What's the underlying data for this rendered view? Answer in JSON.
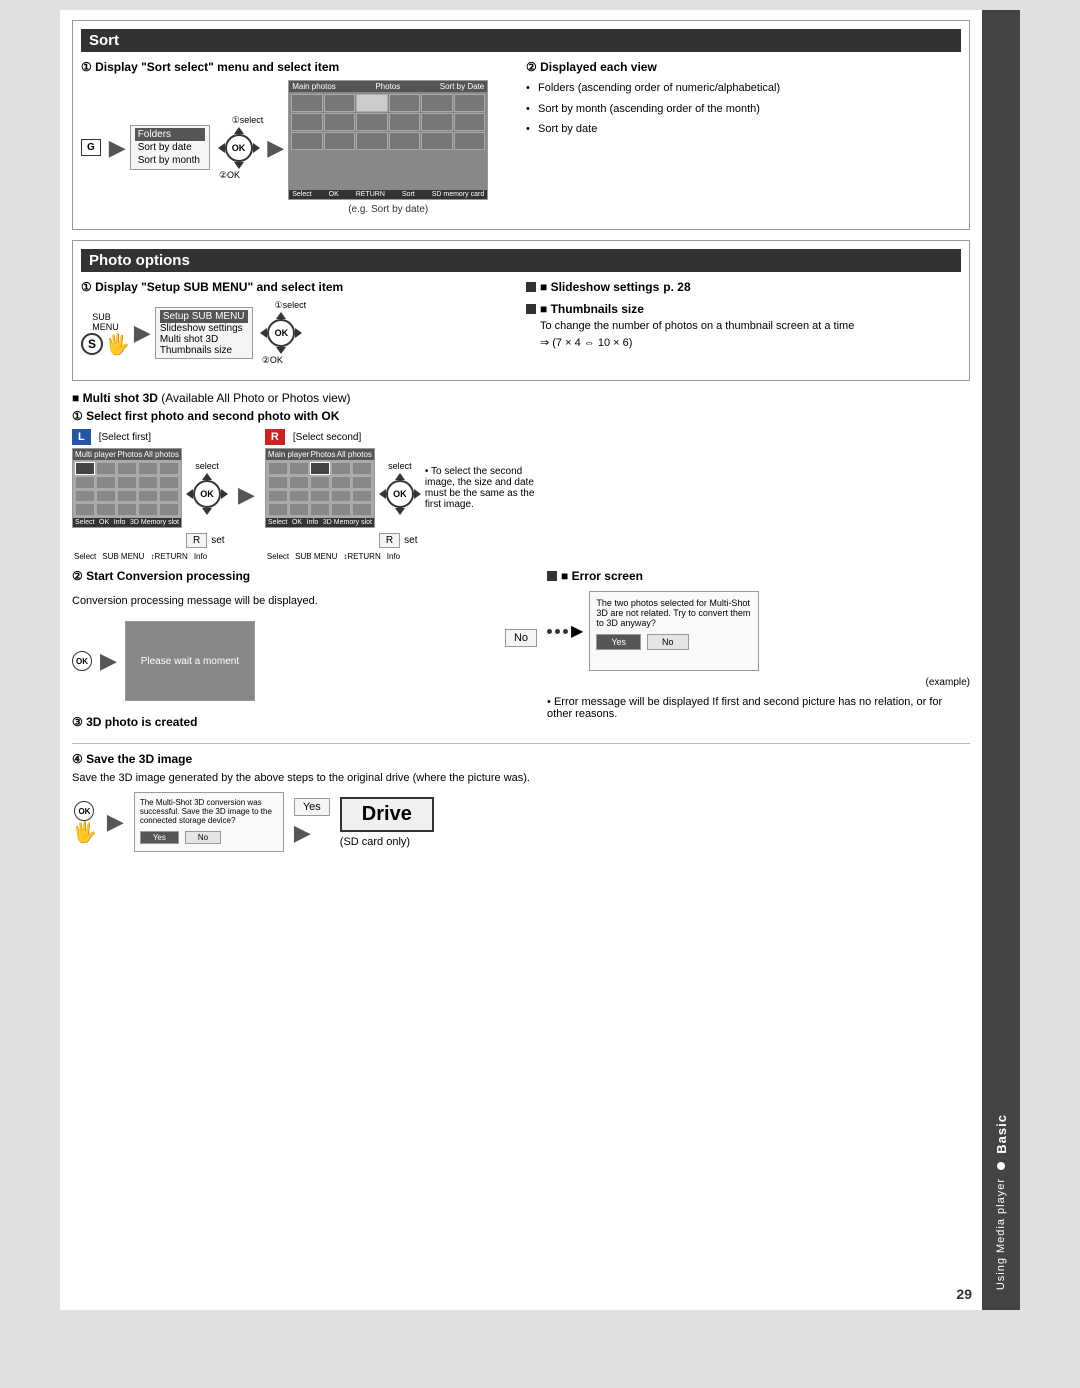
{
  "page": {
    "number": "29",
    "side_tab": {
      "basic_label": "Basic",
      "using_label": "Using Media player"
    }
  },
  "sort_section": {
    "header": "Sort",
    "step1": {
      "title": "① Display \"Sort select\" menu and select item",
      "select_label": "①select",
      "ok_label": "②OK",
      "g_label": "G",
      "menu_items": [
        {
          "label": "Folders",
          "selected": true
        },
        {
          "label": "Sort by date",
          "selected": false
        },
        {
          "label": "Sort by month",
          "selected": false
        }
      ]
    },
    "step2": {
      "title": "② Displayed each view",
      "bullets": [
        "Folders (ascending order of numeric/alphabetical)",
        "Sort by month (ascending order of the month)",
        "Sort by date"
      ],
      "eg_label": "(e.g. Sort by date)"
    }
  },
  "photo_section": {
    "header": "Photo options",
    "step1": {
      "title": "① Display \"Setup SUB MENU\" and select item",
      "select_label": "①select",
      "ok_label": "②OK",
      "s_label": "S",
      "sub_label": "SUB MENU",
      "menu_items": [
        {
          "label": "Setup SUB MENU",
          "selected": true
        },
        {
          "label": "Slideshow settings",
          "selected": false
        },
        {
          "label": "Multi shot 3D",
          "selected": false
        },
        {
          "label": "Thumbnails size",
          "selected": false
        }
      ]
    },
    "slideshow": {
      "title": "■ Slideshow settings",
      "page_ref": "p. 28"
    },
    "thumbnails": {
      "title": "■ Thumbnails size",
      "desc": "To change the number of photos on a thumbnail screen at a time",
      "formula": "⇒ (7 × 4 ⇔ 10 × 6)"
    }
  },
  "multi_shot": {
    "header_label": "■ Multi shot 3D",
    "available_text": "(Available All Photo or Photos view)",
    "step1": {
      "title": "① Select first photo and second photo with OK",
      "select_first_label": "[Select first]",
      "select_second_label": "[Select second]",
      "select_label": "select",
      "set_label": "set",
      "l_badge": "L",
      "r_badge": "R"
    },
    "step2": {
      "title": "② Start Conversion processing",
      "desc": "Conversion processing message will be displayed.",
      "processing_text": "Please wait a moment"
    },
    "step3": {
      "title": "③ 3D photo is created"
    },
    "error_screen": {
      "title": "■ Error screen",
      "message": "The two photos selected for Multi-Shot 3D are not related. Try to convert them to 3D anyway?",
      "yes_label": "Yes",
      "no_label": "No",
      "example_label": "(example)",
      "note": "• Error message will be displayed If first and second picture has no relation, or for other reasons."
    },
    "no_label": "No",
    "step4": {
      "title": "④ Save the 3D image",
      "desc": "Save the 3D image generated by the above steps to the original drive (where the picture was).",
      "yes_label": "Yes",
      "drive_label": "Drive",
      "sd_label": "(SD card only)",
      "save_message": "The Multi-Shot 3D conversion was successful. Save the 3D image to the connected storage device?",
      "save_yes": "Yes",
      "save_no": "No"
    }
  }
}
